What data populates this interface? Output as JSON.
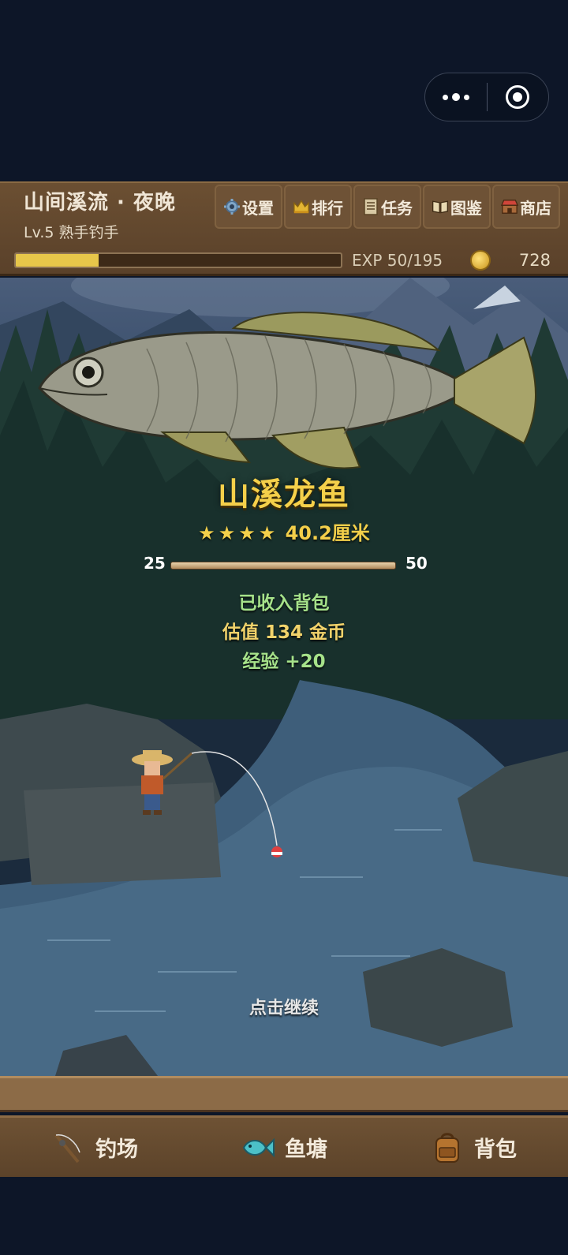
{
  "header": {
    "location": "山间溪流 · 夜晚",
    "level": "Lv.5 熟手钓手",
    "nav": [
      {
        "label": "设置",
        "icon": "gear-icon"
      },
      {
        "label": "排行",
        "icon": "crown-icon"
      },
      {
        "label": "任务",
        "icon": "scroll-icon"
      },
      {
        "label": "图鉴",
        "icon": "book-icon"
      },
      {
        "label": "商店",
        "icon": "shop-icon"
      }
    ],
    "exp_text": "EXP 50/195",
    "exp_progress": 0.256,
    "coins": "728"
  },
  "catch": {
    "fish_name": "山溪龙鱼",
    "stars": "★★★★",
    "size": "40.2厘米",
    "size_min": "25",
    "size_max": "50",
    "status": "已收入背包",
    "value": "估值 134 金币",
    "exp": "经验 +20"
  },
  "prompt": "点击继续",
  "tabs": [
    {
      "label": "钓场",
      "icon": "fishing-rod-icon"
    },
    {
      "label": "鱼塘",
      "icon": "fish-icon"
    },
    {
      "label": "背包",
      "icon": "backpack-icon"
    }
  ],
  "colors": {
    "header_bg": "#6b4f32",
    "exp_fill": "#e7c64a",
    "fish_name": "#f5d04a",
    "status_green": "#a6e28a",
    "value_gold": "#f2d36b"
  }
}
